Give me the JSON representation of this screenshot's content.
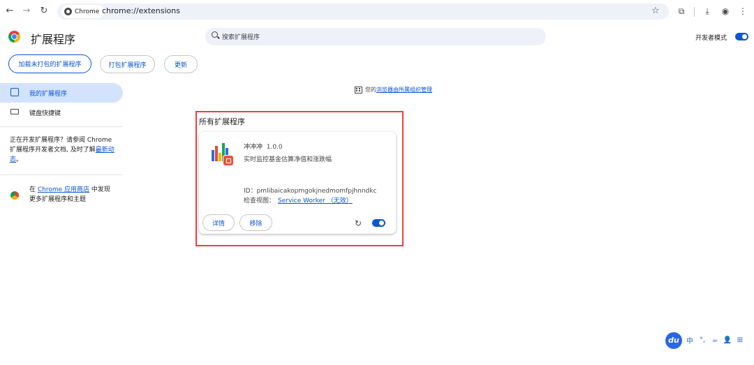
{
  "toolbar": {
    "back_icon": "←",
    "forward_icon": "→",
    "reload_icon": "↻",
    "site_chip": "Chrome",
    "url": "chrome://extensions",
    "bookmark_icon": "☆",
    "extensions_icon": "⧉",
    "download_icon": "⤓",
    "profile_icon": "◉",
    "menu_icon": "⋮"
  },
  "header": {
    "title": "扩展程序",
    "search_placeholder": "搜索扩展程序",
    "dev_mode_label": "开发者模式",
    "dev_mode_on": true
  },
  "actions": {
    "load_unpacked": "加载未打包的扩展程序",
    "pack": "打包扩展程序",
    "update": "更新"
  },
  "sidebar": {
    "items": [
      {
        "label": "我的扩展程序",
        "icon": "puzzle-icon",
        "active": true
      },
      {
        "label": "键盘快捷键",
        "icon": "keyboard-icon",
        "active": false
      }
    ],
    "dev_note_prefix": "正在开发扩展程序？请参阅 Chrome 扩展程序开发者文档, 及时了解",
    "dev_note_link": "最新动态",
    "dev_note_suffix": "。",
    "store_prefix": "在 ",
    "store_link": "Chrome 应用商店",
    "store_suffix": " 中发现更多扩展程序和主题"
  },
  "managed": {
    "prefix": "您的",
    "link": "浏览器由所属组织管理"
  },
  "main": {
    "section_title": "所有扩展程序",
    "extension": {
      "name": "冲冲冲",
      "version": "1.0.0",
      "description": "实时监控基金估算净值和涨跌幅",
      "id_label": "ID：pmlibaicakopmgokjnedmomfpjhnndkc",
      "inspect_label": "检查视图：",
      "inspect_link": "Service Worker （无效）",
      "details_button": "详情",
      "remove_button": "移除",
      "enabled": true
    }
  },
  "ime": {
    "logo": "du",
    "items": [
      "中",
      "°,",
      "☕",
      "👤",
      "⊞"
    ]
  },
  "colors": {
    "accent": "#0b57d0",
    "highlight_box": "#ef3e3e",
    "active_nav": "#d3e3fd"
  }
}
